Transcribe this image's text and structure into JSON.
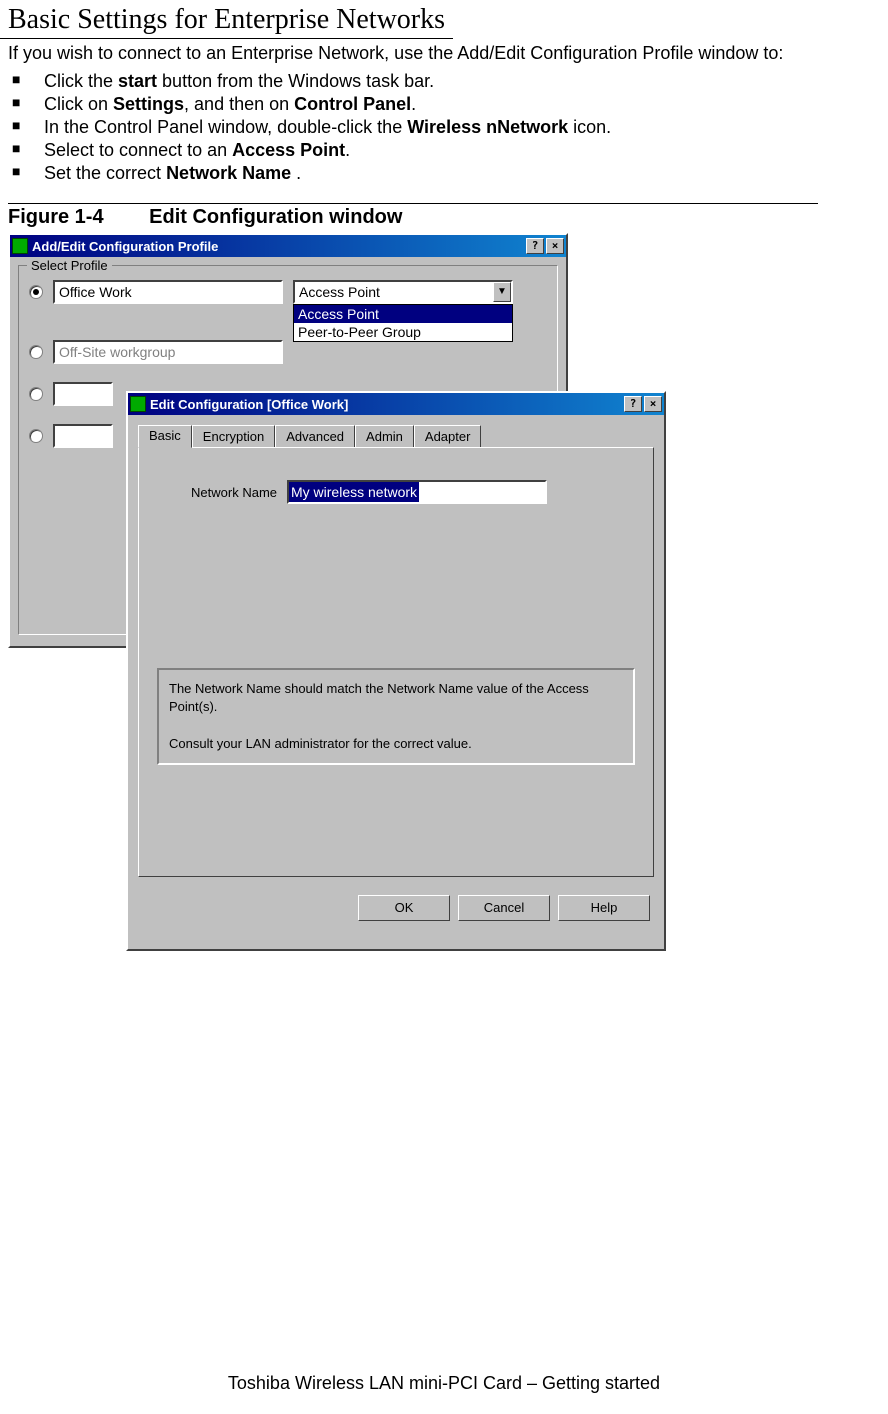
{
  "page": {
    "title": "Basic Settings for Enterprise Networks",
    "intro": "If you wish to connect to an Enterprise Network, use the Add/Edit Configuration Profile window to:",
    "bullets": [
      {
        "pre": "Click the ",
        "b": "start",
        "post": " button from the Windows task bar."
      },
      {
        "pre": "Click on ",
        "b": "Settings",
        "mid": ", and then on ",
        "b2": "Control Panel",
        "post": "."
      },
      {
        "pre": "In the Control Panel window, double-click the ",
        "b": "Wireless nNetwork",
        "post": " icon."
      },
      {
        "pre": "Select to connect to an ",
        "b": "Access Point",
        "post": "."
      },
      {
        "pre": "Set the correct ",
        "b": "Network Name",
        "post": " ."
      }
    ],
    "figure_num": "Figure 1-4",
    "figure_title": "Edit Configuration window",
    "footer": "Toshiba Wireless LAN mini-PCI Card – Getting started"
  },
  "win1": {
    "title": "Add/Edit Configuration Profile",
    "groupbox": "Select Profile",
    "profiles": [
      {
        "name": "Office Work",
        "checked": true,
        "disabled": false
      },
      {
        "name": "Off-Site workgroup",
        "checked": false,
        "disabled": true
      },
      {
        "name": "",
        "checked": false,
        "disabled": false
      },
      {
        "name": "",
        "checked": false,
        "disabled": false
      }
    ],
    "combo_value": "Access Point",
    "combo_options": [
      "Access Point",
      "Peer-to-Peer Group"
    ],
    "help_btn": "?",
    "close_btn": "×"
  },
  "win2": {
    "title": "Edit Configuration [Office Work]",
    "tabs": [
      "Basic",
      "Encryption",
      "Advanced",
      "Admin",
      "Adapter"
    ],
    "active_tab": "Basic",
    "network_name_label": "Network Name",
    "network_name_value": "My wireless network",
    "info_text_1": "The Network Name should match the Network Name value of the Access Point(s).",
    "info_text_2": "Consult your LAN administrator for the correct value.",
    "buttons": {
      "ok": "OK",
      "cancel": "Cancel",
      "help": "Help"
    },
    "help_btn": "?",
    "close_btn": "×"
  }
}
